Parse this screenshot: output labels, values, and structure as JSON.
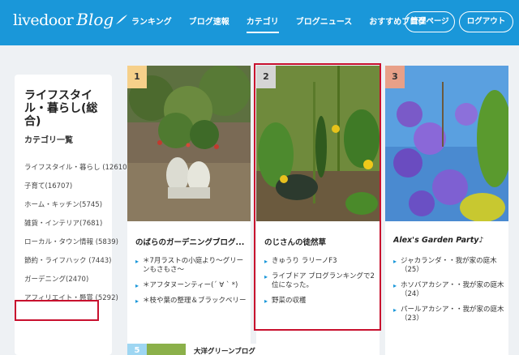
{
  "header": {
    "logo_text": "livedoor",
    "logo_blog": "Blog",
    "nav": [
      "ランキング",
      "ブログ速報",
      "カテゴリ",
      "ブログニュース",
      "おすすめブログ"
    ],
    "admin_button": "管理ページ",
    "logout_button": "ログアウト"
  },
  "sidebar": {
    "title": "ライフスタイル・暮らし(総合)",
    "subtitle": "カテゴリ一覧",
    "items": [
      "ライフスタイル・暮らし (126103)",
      "子育て(16707)",
      "ホーム・キッチン(5745)",
      "雑貨・インテリア(7681)",
      "ローカル・タウン情報 (5839)",
      "節約・ライフハック (7443)",
      "ガーデニング(2470)",
      "アフィリエイト・懸賞 (5292)"
    ]
  },
  "cards": [
    {
      "rank": "1",
      "title": "のばらのガーデニングブログ...",
      "entries": [
        "＊7月ラストの小庭より～グリーンもさもさ～",
        "＊アフタヌーンティー(´ ∀ ` *)",
        "＊枝や葉の整理＆ブラックベリー"
      ]
    },
    {
      "rank": "2",
      "title": "のじさんの徒然草",
      "entries": [
        "きゅうり ラリーノF3",
        "ライブドア ブログランキングで2位になった。",
        "野菜の収穫"
      ]
    },
    {
      "rank": "3",
      "title": "Alex's Garden Party♪",
      "entries": [
        "ジャカランダ・・我が家の庭木（25）",
        "ホソバアカシア・・我が家の庭木（24）",
        "パールアカシア・・我が家の庭木（23）"
      ]
    }
  ],
  "bottom": {
    "rank": "5",
    "title": "大洋グリーンブログ"
  }
}
